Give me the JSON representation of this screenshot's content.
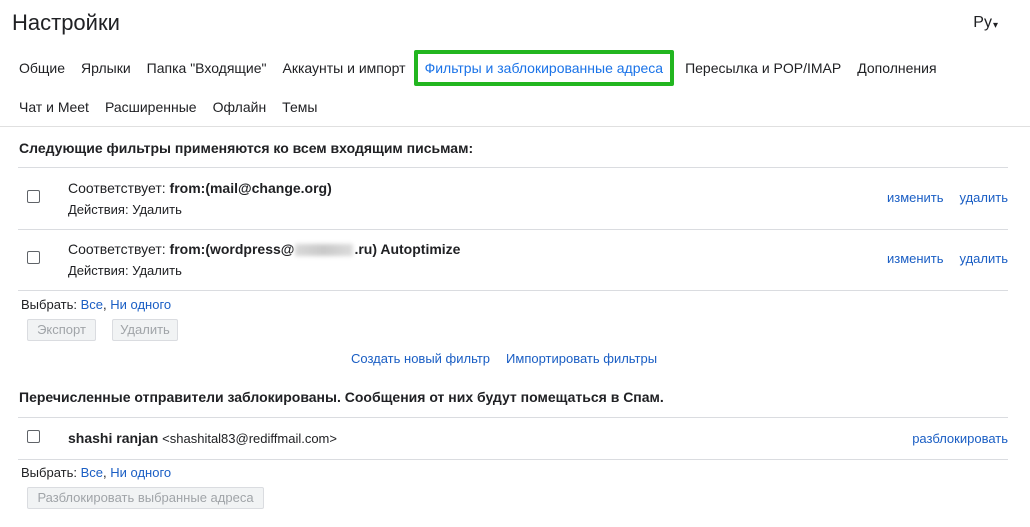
{
  "header": {
    "title": "Настройки",
    "language": "Ру"
  },
  "tabs": [
    {
      "label": "Общие"
    },
    {
      "label": "Ярлыки"
    },
    {
      "label": "Папка \"Входящие\""
    },
    {
      "label": "Аккаунты и импорт"
    },
    {
      "label": "Фильтры и заблокированные адреса",
      "active": true
    },
    {
      "label": "Пересылка и POP/IMAP"
    },
    {
      "label": "Дополнения"
    },
    {
      "label": "Чат и Meet"
    },
    {
      "label": "Расширенные"
    },
    {
      "label": "Офлайн"
    },
    {
      "label": "Темы"
    }
  ],
  "filters": {
    "heading": "Следующие фильтры применяются ко всем входящим письмам:",
    "items": [
      {
        "match_label": "Соответствует:",
        "criteria_before": "from:(mail@change.org)",
        "criteria_after": "",
        "actions_label": "Действия:",
        "action": "Удалить",
        "edit": "изменить",
        "delete": "удалить"
      },
      {
        "match_label": "Соответствует:",
        "criteria_before": "from:(wordpress@",
        "criteria_after": ".ru) Autoptimize",
        "actions_label": "Действия:",
        "action": "Удалить",
        "edit": "изменить",
        "delete": "удалить"
      }
    ],
    "select_label": "Выбрать:",
    "select_all": "Все",
    "select_none": "Ни одного",
    "export_button": "Экспорт",
    "delete_button": "Удалить",
    "create_filter": "Создать новый фильтр",
    "import_filters": "Импортировать фильтры"
  },
  "blocked": {
    "heading": "Перечисленные отправители заблокированы. Сообщения от них будут помещаться в Спам.",
    "items": [
      {
        "name": "shashi ranjan",
        "email": "<shashital83@rediffmail.com>",
        "unblock": "разблокировать"
      }
    ],
    "select_label": "Выбрать:",
    "select_all": "Все",
    "select_none": "Ни одного",
    "unblock_button": "Разблокировать выбранные адреса"
  },
  "colors": {
    "link": "#1a5ec4",
    "active_tab": "#1a73e8",
    "highlight": "#22b620"
  }
}
